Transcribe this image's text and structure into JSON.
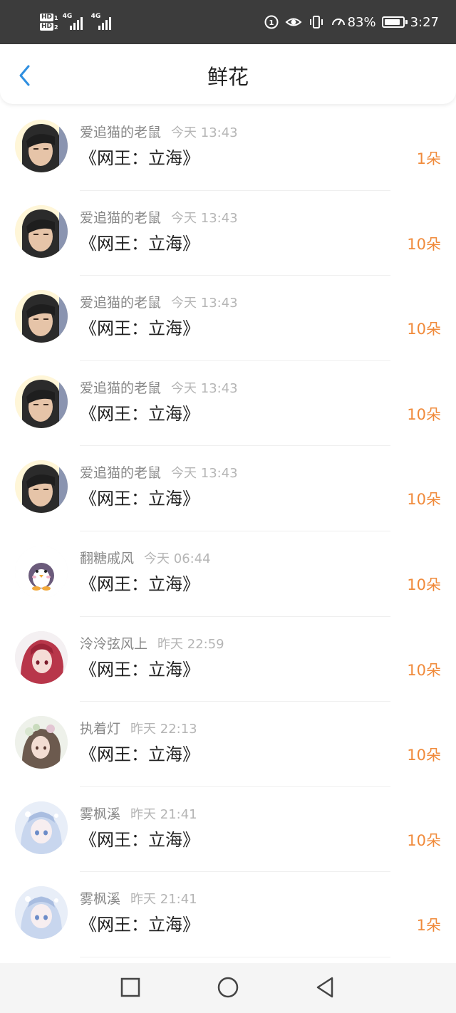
{
  "status_bar": {
    "hd1": "HD",
    "hd1_sub": "1",
    "hd2": "HD",
    "hd2_sub": "2",
    "net1": "4G",
    "net2": "4G",
    "battery": "83%",
    "time": "3:27"
  },
  "header": {
    "title": "鲜花"
  },
  "items": [
    {
      "name": "爱追猫的老鼠",
      "time": "今天 13:43",
      "book": "《网王：立海》",
      "amount": "1朵",
      "avatar": "male-photo-avatar"
    },
    {
      "name": "爱追猫的老鼠",
      "time": "今天 13:43",
      "book": "《网王：立海》",
      "amount": "10朵",
      "avatar": "male-photo-avatar"
    },
    {
      "name": "爱追猫的老鼠",
      "time": "今天 13:43",
      "book": "《网王：立海》",
      "amount": "10朵",
      "avatar": "male-photo-avatar"
    },
    {
      "name": "爱追猫的老鼠",
      "time": "今天 13:43",
      "book": "《网王：立海》",
      "amount": "10朵",
      "avatar": "male-photo-avatar"
    },
    {
      "name": "爱追猫的老鼠",
      "time": "今天 13:43",
      "book": "《网王：立海》",
      "amount": "10朵",
      "avatar": "male-photo-avatar"
    },
    {
      "name": "翻糖戚风",
      "time": "今天 06:44",
      "book": "《网王：立海》",
      "amount": "10朵",
      "avatar": "penguin-avatar"
    },
    {
      "name": "泠泠弦风上",
      "time": "昨天 22:59",
      "book": "《网王：立海》",
      "amount": "10朵",
      "avatar": "anime-red-hair-avatar"
    },
    {
      "name": "执着灯",
      "time": "昨天 22:13",
      "book": "《网王：立海》",
      "amount": "10朵",
      "avatar": "anime-flower-girl-avatar"
    },
    {
      "name": "雾枫溪",
      "time": "昨天 21:41",
      "book": "《网王：立海》",
      "amount": "10朵",
      "avatar": "anime-blue-girl-avatar"
    },
    {
      "name": "雾枫溪",
      "time": "昨天 21:41",
      "book": "《网王：立海》",
      "amount": "1朵",
      "avatar": "anime-blue-girl-avatar"
    }
  ],
  "colors": {
    "accent_back": "#2f8fe0",
    "amount": "#f08a3a",
    "status_bar_bg": "#3c3c3c"
  },
  "nav": {
    "icons": [
      "recent-apps-icon",
      "home-icon",
      "back-triangle-icon"
    ]
  }
}
